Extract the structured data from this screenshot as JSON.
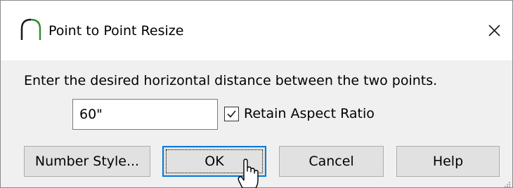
{
  "window": {
    "title": "Point to Point Resize",
    "app_icon": "arch-icon",
    "close_icon": "close-icon"
  },
  "prompt": "Enter the desired horizontal distance between the two points.",
  "distance_input": {
    "value": "60\""
  },
  "retain_aspect_ratio": {
    "label": "Retain Aspect Ratio",
    "checked": true
  },
  "buttons": {
    "number_style": "Number Style...",
    "ok": "OK",
    "cancel": "Cancel",
    "help": "Help"
  },
  "colors": {
    "accent": "#0078d7",
    "icon_green": "#2e8b2e",
    "dialog_bg": "#f0f0f0",
    "button_bg": "#e1e1e1"
  }
}
